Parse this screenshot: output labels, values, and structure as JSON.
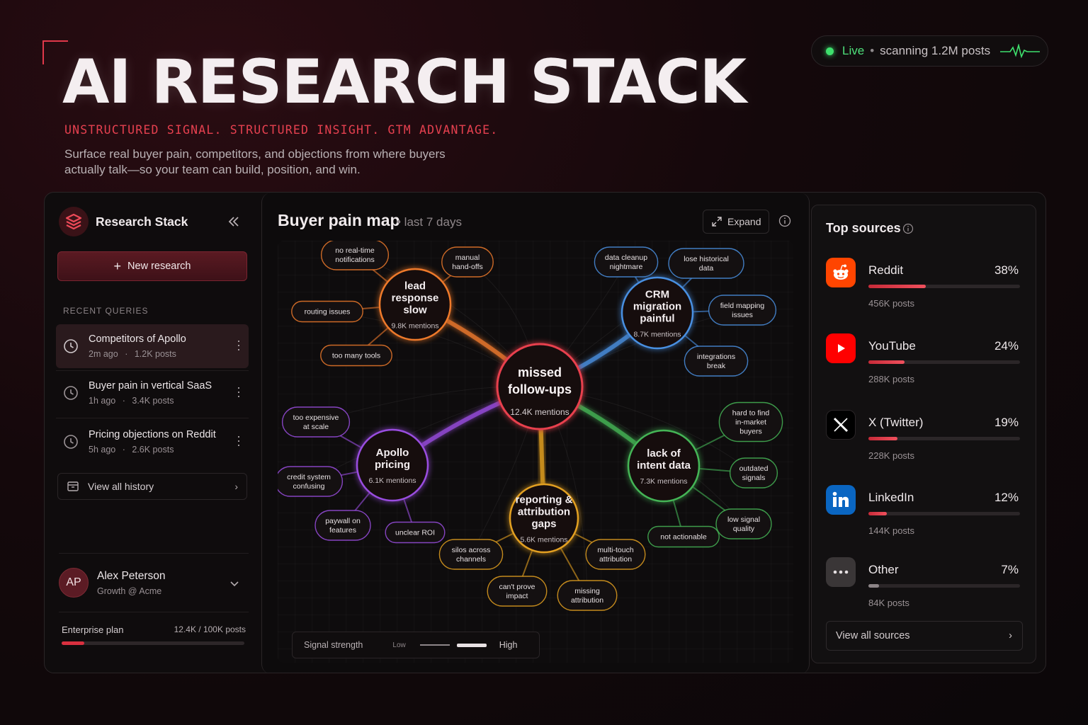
{
  "hero": {
    "title": "AI RESEARCH STACK",
    "tagline": "UNSTRUCTURED SIGNAL. STRUCTURED INSIGHT. GTM ADVANTAGE.",
    "subtitle": "Surface real buyer pain, competitors, and objections from where buyers actually talk—so your team can build, position, and win."
  },
  "status": {
    "live_label": "Live",
    "separator": "•",
    "text": "scanning 1.2M posts",
    "color": "#3ee06d"
  },
  "sidebar": {
    "brand": "Research Stack",
    "new_research": "New research",
    "recent_label": "RECENT QUERIES",
    "queries": [
      {
        "title": "Competitors of Apollo",
        "time": "2m ago",
        "posts": "1.2K posts",
        "active": true
      },
      {
        "title": "Buyer pain in vertical SaaS",
        "time": "1h ago",
        "posts": "3.4K posts",
        "active": false
      },
      {
        "title": "Pricing objections on Reddit",
        "time": "5h ago",
        "posts": "2.6K posts",
        "active": false
      }
    ],
    "meta_sep": "·",
    "view_history": "View all history",
    "user": {
      "initials": "AP",
      "name": "Alex Peterson",
      "role": "Growth @ Acme"
    },
    "plan": {
      "label": "Enterprise plan",
      "usage": "12.4K / 100K posts",
      "fraction": 0.124
    }
  },
  "map": {
    "title": "Buyer pain map",
    "range": "• last 7 days",
    "expand": "Expand",
    "legend": {
      "label": "Signal strength",
      "low": "Low",
      "high": "High"
    },
    "center": {
      "label": "missed follow-ups",
      "mentions": "12.4K mentions",
      "color": "#e8404e"
    },
    "clusters": [
      {
        "id": "lead",
        "label": "lead response slow",
        "mentions": "9.8K mentions",
        "color": "#ef7a2c",
        "leaves": [
          "no real-time notifications",
          "manual hand-offs",
          "routing issues",
          "too many tools"
        ]
      },
      {
        "id": "crm",
        "label": "CRM migration painful",
        "mentions": "8.7K mentions",
        "color": "#4a90e2",
        "leaves": [
          "data cleanup nightmare",
          "lose historical data",
          "field mapping issues",
          "integrations break"
        ]
      },
      {
        "id": "intent",
        "label": "lack of intent data",
        "mentions": "7.3K mentions",
        "color": "#45b556",
        "leaves": [
          "hard to find in-market buyers",
          "outdated signals",
          "low signal quality",
          "not actionable"
        ]
      },
      {
        "id": "reporting",
        "label": "reporting & attribution gaps",
        "mentions": "5.6K mentions",
        "color": "#e3a020",
        "leaves": [
          "silos across channels",
          "can't prove impact",
          "missing attribution",
          "multi-touch attribution"
        ]
      },
      {
        "id": "pricing",
        "label": "Apollo pricing",
        "mentions": "6.1K mentions",
        "color": "#9a4ee0",
        "leaves": [
          "too expensive at scale",
          "credit system confusing",
          "paywall on features",
          "unclear ROI"
        ]
      }
    ]
  },
  "sources": {
    "title": "Top sources",
    "items": [
      {
        "name": "Reddit",
        "pct": "38%",
        "value": 38,
        "posts": "456K posts",
        "icon": "reddit-icon",
        "color": "#ff4500"
      },
      {
        "name": "YouTube",
        "pct": "24%",
        "value": 24,
        "posts": "288K posts",
        "icon": "youtube-icon",
        "color": "#ff0000"
      },
      {
        "name": "X (Twitter)",
        "pct": "19%",
        "value": 19,
        "posts": "228K posts",
        "icon": "x-icon",
        "color": "#000000"
      },
      {
        "name": "LinkedIn",
        "pct": "12%",
        "value": 12,
        "posts": "144K posts",
        "icon": "linkedin-icon",
        "color": "#0a66c2"
      },
      {
        "name": "Other",
        "pct": "7%",
        "value": 7,
        "posts": "84K posts",
        "icon": "more-icon",
        "color": "#3a3637"
      }
    ],
    "view_all": "View all sources"
  }
}
